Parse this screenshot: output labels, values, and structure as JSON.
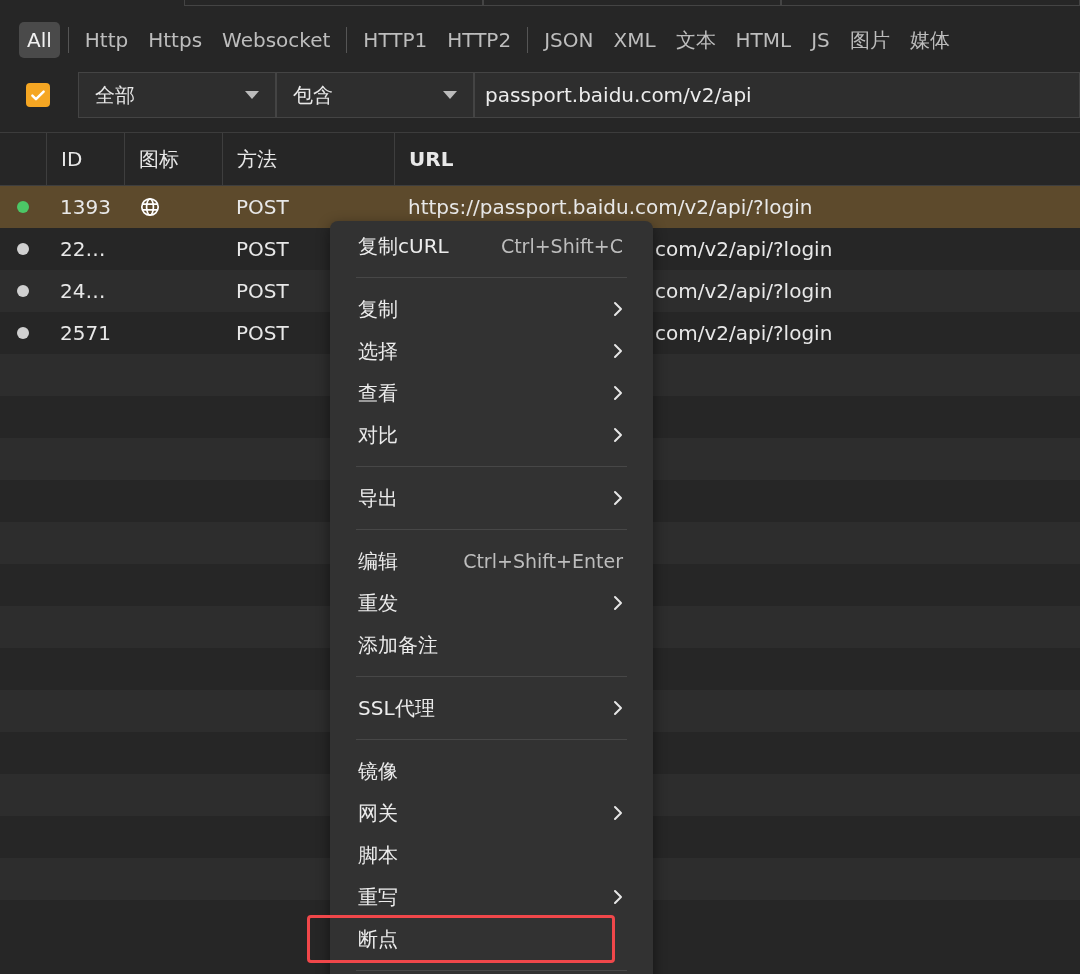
{
  "type_filter": {
    "groups": [
      [
        {
          "label": "All",
          "selected": true
        }
      ],
      [
        {
          "label": "Http",
          "selected": false
        },
        {
          "label": "Https",
          "selected": false
        },
        {
          "label": "Websocket",
          "selected": false
        }
      ],
      [
        {
          "label": "HTTP1",
          "selected": false
        },
        {
          "label": "HTTP2",
          "selected": false
        }
      ],
      [
        {
          "label": "JSON",
          "selected": false
        },
        {
          "label": "XML",
          "selected": false
        },
        {
          "label": "文本",
          "selected": false
        },
        {
          "label": "HTML",
          "selected": false
        },
        {
          "label": "JS",
          "selected": false
        },
        {
          "label": "图片",
          "selected": false
        },
        {
          "label": "媒体",
          "selected": false
        }
      ]
    ]
  },
  "filter_row": {
    "enabled": {
      "checked": true
    },
    "scope": "全部",
    "match": "包含",
    "value": "passport.baidu.com/v2/api"
  },
  "table": {
    "columns": [
      "ID",
      "图标",
      "方法",
      "URL"
    ],
    "rows": [
      {
        "color": "#4cc766",
        "id": "1393",
        "globe_icon": true,
        "method": "POST",
        "url": "https://passport.baidu.com/v2/api/?login",
        "selected": true
      },
      {
        "color": "#d0d0d0",
        "id": "22…",
        "globe_icon": false,
        "method": "POST",
        "url": "com/v2/api/?login",
        "selected": false
      },
      {
        "color": "#d0d0d0",
        "id": "24…",
        "globe_icon": false,
        "method": "POST",
        "url": "com/v2/api/?login",
        "selected": false
      },
      {
        "color": "#d0d0d0",
        "id": "2571",
        "globe_icon": false,
        "method": "POST",
        "url": "com/v2/api/?login",
        "selected": false
      }
    ]
  },
  "context_menu": {
    "sections": [
      [
        {
          "label": "复制cURL",
          "shortcut": "Ctrl+Shift+C",
          "submenu": false,
          "highlighted": false
        }
      ],
      [
        {
          "label": "复制",
          "submenu": true,
          "highlighted": false
        },
        {
          "label": "选择",
          "submenu": true,
          "highlighted": false
        },
        {
          "label": "查看",
          "submenu": true,
          "highlighted": false
        },
        {
          "label": "对比",
          "submenu": true,
          "highlighted": false
        }
      ],
      [
        {
          "label": "导出",
          "submenu": true,
          "highlighted": false
        }
      ],
      [
        {
          "label": "编辑",
          "shortcut": "Ctrl+Shift+Enter",
          "submenu": false,
          "highlighted": false
        },
        {
          "label": "重发",
          "submenu": true,
          "highlighted": false
        },
        {
          "label": "添加备注",
          "submenu": false,
          "highlighted": false
        }
      ],
      [
        {
          "label": "SSL代理",
          "submenu": true,
          "highlighted": false
        }
      ],
      [
        {
          "label": "镜像",
          "submenu": false,
          "highlighted": false
        },
        {
          "label": "网关",
          "submenu": true,
          "highlighted": false
        },
        {
          "label": "脚本",
          "submenu": false,
          "highlighted": false
        },
        {
          "label": "重写",
          "submenu": true,
          "highlighted": false
        },
        {
          "label": "断点",
          "submenu": false,
          "highlighted": true
        }
      ]
    ]
  }
}
